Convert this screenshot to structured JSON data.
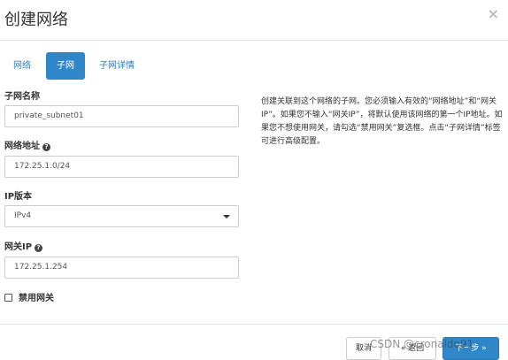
{
  "dialog": {
    "title": "创建网络",
    "close_glyph": "×"
  },
  "tabs": [
    {
      "label": "网络",
      "active": false
    },
    {
      "label": "子网",
      "active": true
    },
    {
      "label": "子网详情",
      "active": false
    }
  ],
  "form": {
    "subnet_name": {
      "label": "子网名称",
      "value": "private_subnet01"
    },
    "network_address": {
      "label": "网络地址",
      "value": "172.25.1.0/24",
      "help_glyph": "?"
    },
    "ip_version": {
      "label": "IP版本",
      "value": "IPv4"
    },
    "gateway_ip": {
      "label": "网关IP",
      "value": "172.25.1.254",
      "help_glyph": "?"
    },
    "disable_gateway": {
      "label": "禁用网关",
      "checked": false
    }
  },
  "help_text": "创建关联到这个网络的子网。您必须输入有效的“网络地址”和“网关IP”。如果您不输入“网关IP”，将默认使用该网络的第一个IP地址。如果您不想使用网关，请勾选“禁用网关”复选框。点击“子网详情”标签可进行高级配置。",
  "footer": {
    "cancel_label": "取消",
    "back_label": "« 返回",
    "next_label": "下一步 »"
  },
  "watermark": "CSDN @cronaldo91",
  "colors": {
    "primary": "#2f87c9",
    "link": "#2a7dbf",
    "border": "#cccccc"
  }
}
